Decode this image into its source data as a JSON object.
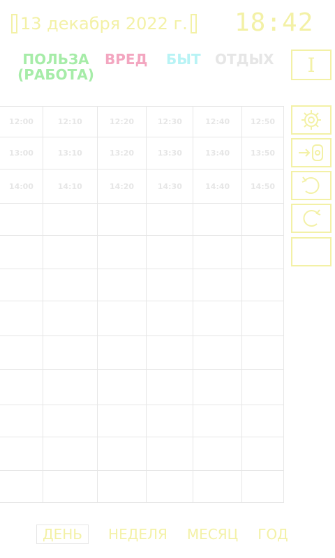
{
  "header": {
    "date": "13 декабря 2022 г.",
    "time": "18:42"
  },
  "categories": [
    {
      "label": "ПОЛЬЗА\n(РАБОТА)",
      "color": "#a6eca8"
    },
    {
      "label": "ВРЕД",
      "color": "#f3a6c0"
    },
    {
      "label": "БЫТ",
      "color": "#b8f3f5"
    },
    {
      "label": "ОТДЫХ",
      "color": "#e6e6e6"
    }
  ],
  "side_buttons": {
    "top_label": "I",
    "icons": [
      "settings-icon",
      "import-icon",
      "undo-icon",
      "redo-icon",
      "empty-button"
    ]
  },
  "grid": {
    "rows": [
      [
        "12:00",
        "12:10",
        "12:20",
        "12:30",
        "12:40",
        "12:50"
      ],
      [
        "13:00",
        "13:10",
        "13:20",
        "13:30",
        "13:40",
        "13:50"
      ],
      [
        "14:00",
        "14:10",
        "14:20",
        "14:30",
        "14:40",
        "14:50"
      ],
      [
        "",
        "",
        "",
        "",
        "",
        ""
      ],
      [
        "",
        "",
        "",
        "",
        "",
        ""
      ],
      [
        "",
        "",
        "",
        "",
        "",
        ""
      ],
      [
        "",
        "",
        "",
        "",
        "",
        ""
      ],
      [
        "",
        "",
        "",
        "",
        "",
        ""
      ],
      [
        "",
        "",
        "",
        "",
        "",
        ""
      ],
      [
        "",
        "",
        "",
        "",
        "",
        ""
      ],
      [
        "",
        "",
        "",
        "",
        "",
        ""
      ],
      [
        "",
        "",
        "",
        "",
        "",
        ""
      ]
    ]
  },
  "tabs": [
    "ДЕНЬ",
    "НЕДЕЛЯ",
    "МЕСЯЦ",
    "ГОД"
  ],
  "active_tab": "ДЕНЬ",
  "colors": {
    "accent": "#f3f1a6",
    "grid_line": "#e6e6e6"
  }
}
